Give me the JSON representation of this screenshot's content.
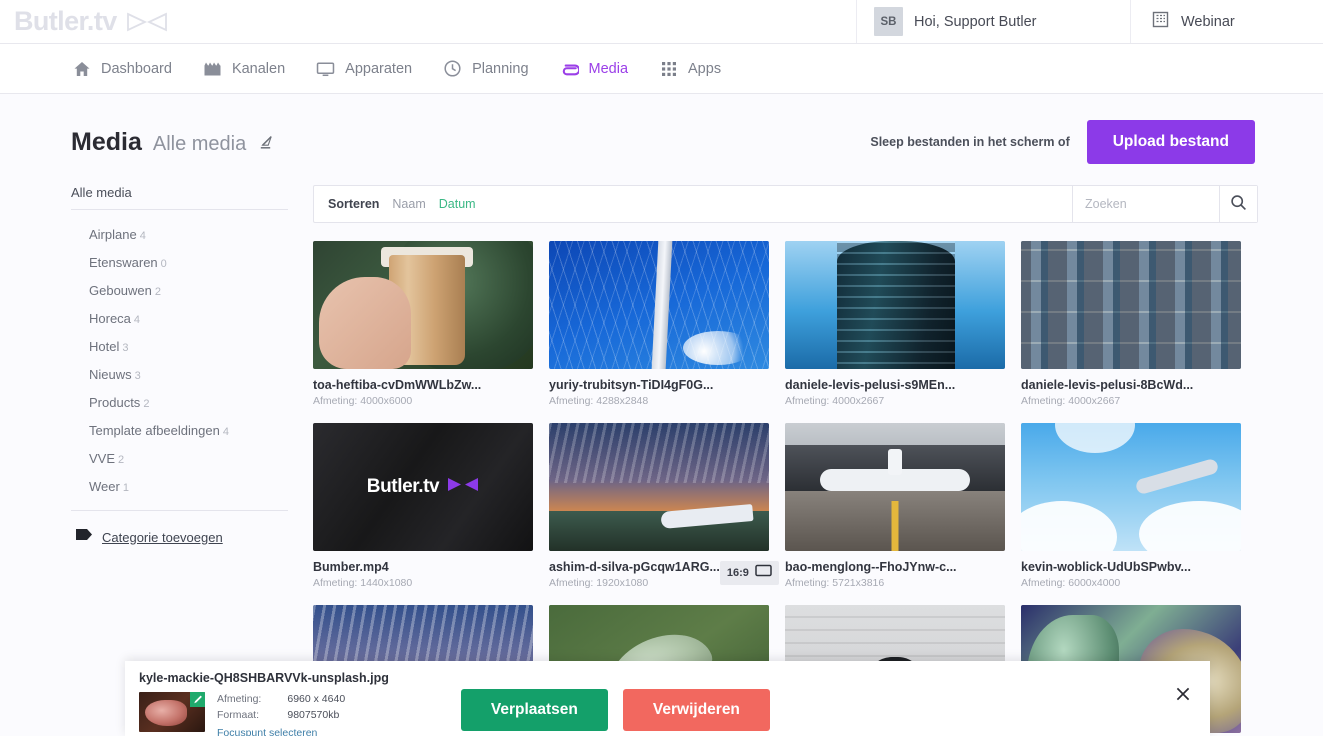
{
  "header": {
    "brand": "Butler.tv",
    "brand_icon": "bowtie-logo-icon",
    "user_initials": "SB",
    "user_greeting": "Hoi, Support Butler",
    "webinar_label": "Webinar",
    "webinar_icon": "building-icon"
  },
  "nav": {
    "items": [
      {
        "label": "Dashboard",
        "icon": "home-icon",
        "active": false
      },
      {
        "label": "Kanalen",
        "icon": "film-clapper-icon",
        "active": false
      },
      {
        "label": "Apparaten",
        "icon": "monitor-icon",
        "active": false
      },
      {
        "label": "Planning",
        "icon": "clock-icon",
        "active": false
      },
      {
        "label": "Media",
        "icon": "paperclip-icon",
        "active": true
      },
      {
        "label": "Apps",
        "icon": "grid-dots-icon",
        "active": false
      }
    ],
    "active_color": "#9b3fe8"
  },
  "page": {
    "title": "Media",
    "subtitle": "Alle media",
    "edit_icon": "pencil-icon",
    "upload_hint": "Sleep bestanden in het scherm of",
    "upload_button": "Upload bestand",
    "upload_button_color": "#8c3ae8"
  },
  "sidebar": {
    "heading": "Alle media",
    "items": [
      {
        "label": "Airplane",
        "count": "4"
      },
      {
        "label": "Etenswaren",
        "count": "0"
      },
      {
        "label": "Gebouwen",
        "count": "2"
      },
      {
        "label": "Horeca",
        "count": "4"
      },
      {
        "label": "Hotel",
        "count": "3"
      },
      {
        "label": "Nieuws",
        "count": "3"
      },
      {
        "label": "Products",
        "count": "2"
      },
      {
        "label": "Template afbeeldingen",
        "count": "4"
      },
      {
        "label": "VVE",
        "count": "2"
      },
      {
        "label": "Weer",
        "count": "1"
      }
    ],
    "add_category": "Categorie toevoegen",
    "add_category_icon": "tag-icon"
  },
  "toolbar": {
    "sort_label": "Sorteren",
    "sort_options": [
      {
        "label": "Naam",
        "active": false
      },
      {
        "label": "Datum",
        "active": true
      }
    ],
    "active_sort_color": "#3bb885",
    "search_placeholder": "Zoeken",
    "search_value": "",
    "search_icon": "search-icon"
  },
  "grid": {
    "dimension_label": "Afmeting:",
    "items": [
      {
        "title": "toa-heftiba-cvDmWWLbZw...",
        "meta": "Afmeting: 4000x6000",
        "art": "art-coffee",
        "selected": false,
        "badge": null
      },
      {
        "title": "yuriy-trubitsyn-TiDI4gF0G...",
        "meta": "Afmeting: 4288x2848",
        "art": "art-bridge",
        "selected": false,
        "badge": null
      },
      {
        "title": "daniele-levis-pelusi-s9MEn...",
        "meta": "Afmeting: 4000x2667",
        "art": "art-tower",
        "selected": false,
        "badge": null
      },
      {
        "title": "daniele-levis-pelusi-8BcWd...",
        "meta": "Afmeting: 4000x2667",
        "art": "art-facade",
        "selected": false,
        "badge": null
      },
      {
        "title": "Bumber.mp4",
        "meta": "Afmeting: 1440x1080",
        "art": "art-butler",
        "selected": false,
        "badge": null
      },
      {
        "title": "ashim-d-silva-pGcqw1ARG...",
        "meta": "Afmeting: 1920x1080",
        "art": "art-sunset-plane",
        "selected": false,
        "badge": "16:9"
      },
      {
        "title": "bao-menglong--FhoJYnw-c...",
        "meta": "Afmeting: 5721x3816",
        "art": "art-runway",
        "selected": false,
        "badge": null
      },
      {
        "title": "kevin-woblick-UdUbSPwbv...",
        "meta": "Afmeting: 6000x4000",
        "art": "art-sky-plane",
        "selected": false,
        "badge": null
      },
      {
        "title": "",
        "meta": "",
        "art": "art-dusk",
        "selected": false,
        "badge": null
      },
      {
        "title": "",
        "meta": "",
        "art": "art-green",
        "selected": true,
        "badge": null
      },
      {
        "title": "",
        "meta": "",
        "art": "art-umbrella",
        "selected": false,
        "badge": null
      },
      {
        "title": "",
        "meta": "",
        "art": "art-succulent",
        "selected": false,
        "badge": null
      }
    ],
    "badge_icon": "screen-ratio-icon"
  },
  "selection_panel": {
    "filename": "kyle-mackie-QH8SHBARVVk-unsplash.jpg",
    "thumb_art": "art-steak",
    "check_icon": "pencil-check-icon",
    "dimension_key": "Afmeting:",
    "dimension_value": "6960 x 4640",
    "format_key": "Formaat:",
    "format_value": "9807570kb",
    "focus_link": "Focuspunt selecteren",
    "move_button": "Verplaatsen",
    "delete_button": "Verwijderen",
    "move_color": "#14a06a",
    "delete_color": "#f2685f",
    "close_icon": "close-icon"
  }
}
